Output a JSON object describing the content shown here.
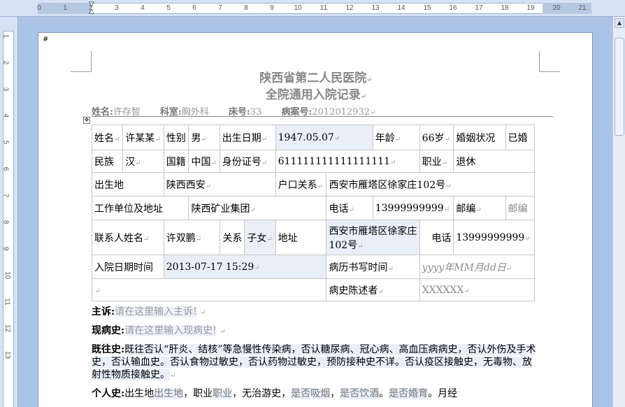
{
  "ruler": {
    "h_numbers": [
      "0",
      "1",
      "2",
      "3",
      "4",
      "5",
      "6",
      "7",
      "8",
      "9",
      "10",
      "11",
      "12",
      "13",
      "14",
      "15",
      "16",
      "17",
      "18",
      "19",
      "20",
      "21"
    ],
    "v_numbers": [
      "1",
      "2",
      "3",
      "4",
      "5",
      "6",
      "7",
      "8",
      "9",
      "10",
      "11",
      "12",
      "13"
    ]
  },
  "page": {
    "hash": "#",
    "title1": "陕西省第二人民医院",
    "title2": "全院通用入院记录",
    "mark": "↵"
  },
  "patient_line": {
    "name_label": "姓名:",
    "name_value": "许存智",
    "dept_label": "科室:",
    "dept_value": "胸外科",
    "bed_label": "床号:",
    "bed_value": "33",
    "case_label": "病案号:",
    "case_value": "2012012932"
  },
  "form": {
    "r1": {
      "name_label": "姓名",
      "name_value": "许某某",
      "sex_label": "性别",
      "sex_value": "男",
      "birth_label": "出生日期",
      "birth_value": "1947.05.07",
      "age_label": "年龄",
      "age_value": "66岁",
      "marital_label": "婚姻状况",
      "marital_value": "已婚"
    },
    "r2": {
      "ethnic_label": "民族",
      "ethnic_value": "汉",
      "nation_label": "国籍",
      "nation_value": "中国",
      "id_label": "身份证号",
      "id_value": "611111111111111111",
      "job_label": "职业",
      "job_value": "退休"
    },
    "r3": {
      "birthplace_label": "出生地",
      "birthplace_value": "陕西西安",
      "hukou_label": "户口关系",
      "hukou_value": "西安市雁塔区徐家庄102号"
    },
    "r4": {
      "work_label": "工作单位及地址",
      "work_value": "陕西矿业集团",
      "phone_label": "电话",
      "phone_value": "13999999999",
      "zip_label": "邮编",
      "zip_value": "邮编"
    },
    "r5": {
      "contact_label": "联系人姓名",
      "contact_value": "许双鹏",
      "relation_label": "关系",
      "relation_value": "子女",
      "addr_label": "地址",
      "addr_value": "西安市雁塔区徐家庄102号",
      "phone_label": "电话",
      "phone_value": "13999999999"
    },
    "r6": {
      "admit_label": "入院日期时间",
      "admit_value": "2013-07-17 15:29",
      "write_label": "病历书写时间",
      "write_value": "yyyy年MM月dd日"
    },
    "r7": {
      "narrator_label": "病史陈述者",
      "narrator_value": "XXXXXX"
    }
  },
  "body": {
    "complaint_label": "主诉:",
    "complaint_hint": "请在这里输入主诉!",
    "present_label": "现病史:",
    "present_hint": "请在这里输入现病史!",
    "past_label": "既往史:",
    "past_text": "既往否认“肝炎、结核”等急慢性传染病，否认糖尿病、冠心病、高血压病病史，否认外伤及手术史，否认输血史。否认食物过敏史，否认药物过敏史，预防接种史不详。否认疫区接触史，无毒物、放射性物质接触史。",
    "personal_label": "个人史:",
    "personal_t1": "出生地",
    "personal_f1": "出生地",
    "personal_t2": "，职业",
    "personal_f2": "职业",
    "personal_t3": "，无治游史，",
    "personal_f3": "是否吸烟",
    "personal_t4": "，",
    "personal_f4": "是否饮酒",
    "personal_t5": "。",
    "personal_f5": "是否婚育",
    "personal_t6": "。月经"
  }
}
